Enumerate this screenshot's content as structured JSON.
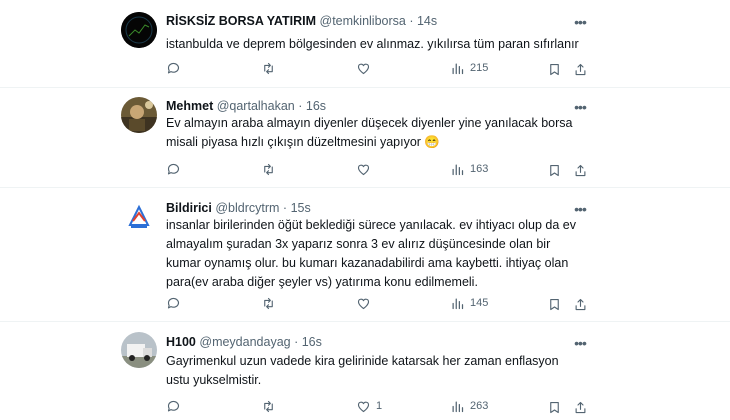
{
  "tweets": [
    {
      "name": "RİSKSİZ BORSA YATIRIM",
      "handle": "@temkinliborsa",
      "sep": "·",
      "time": "14s",
      "text": "istanbulda ve deprem bölgesinden ev alınmaz. yıkılırsa tüm paran sıfırlanır",
      "replies": "",
      "retweets": "",
      "likes": "",
      "views": "215"
    },
    {
      "name": "Mehmet",
      "handle": "@qartalhakan",
      "sep": "·",
      "time": "16s",
      "text": "Ev almayın araba almayın diyenler düşecek diyenler yine yanılacak borsa misali piyasa hızlı çıkışın düzeltmesini yapıyor 😁",
      "replies": "",
      "retweets": "",
      "likes": "",
      "views": "163"
    },
    {
      "name": "Bildirici",
      "handle": "@bldrcytrm",
      "sep": "·",
      "time": "15s",
      "text": "insanlar birilerinden öğüt beklediği sürece yanılacak. ev ihtiyacı olup da ev almayalım şuradan 3x yaparız sonra 3 ev alırız düşüncesinde olan bir kumar oynamış olur. bu kumarı kazanadabilirdi ama kaybetti. ihtiyaç olan para(ev araba diğer şeyler vs) yatırıma konu edilmemeli.",
      "replies": "",
      "retweets": "",
      "likes": "",
      "views": "145"
    },
    {
      "name": "H100",
      "handle": "@meydandayag",
      "sep": "·",
      "time": "16s",
      "text": "Gayrimenkul uzun vadede kira gelirinide katarsak her zaman enflasyon ustu yukselmistir.",
      "replies": "",
      "retweets": "",
      "likes": "1",
      "views": "263"
    }
  ],
  "icons": {
    "more": "more-horizontal-icon",
    "reply": "reply-icon",
    "retweet": "retweet-icon",
    "like": "like-icon",
    "views": "views-icon",
    "bookmark": "bookmark-icon",
    "share": "share-icon"
  },
  "colors": {
    "text": "#0f1419",
    "secondary": "#536471",
    "divider": "#eff3f4"
  }
}
